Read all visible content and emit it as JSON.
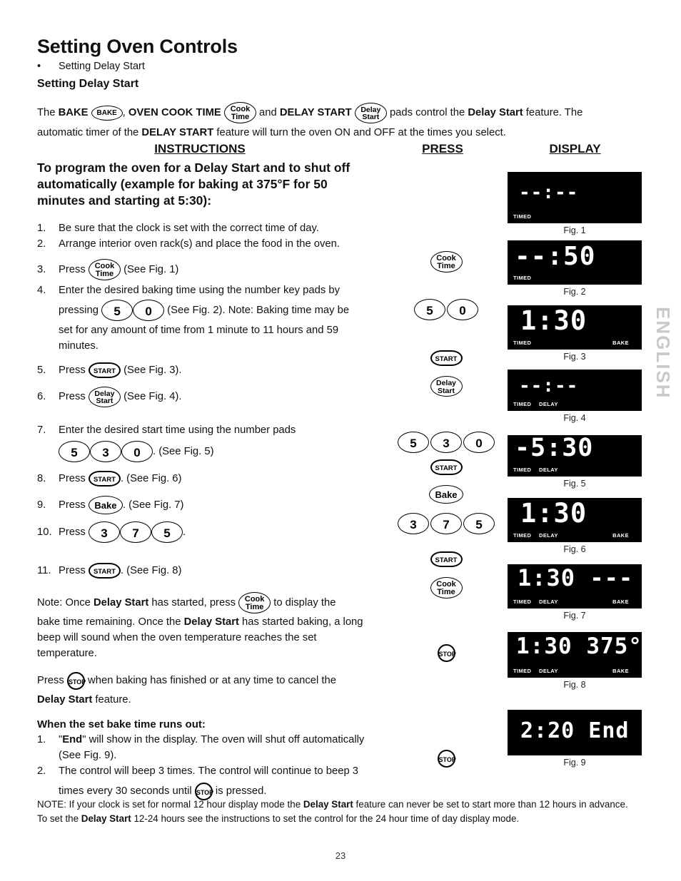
{
  "header": {
    "title": "Setting Oven Controls",
    "bullet": "Setting Delay Start",
    "subtitle": "Setting Delay Start"
  },
  "intro": {
    "p1_a": "The ",
    "p1_bake_label": "BAKE",
    "p1_b": ", ",
    "p1_cook_label": "OVEN COOK TIME",
    "p1_c": " and ",
    "p1_delay_label": "DELAY START",
    "p1_d": " pads control the ",
    "p1_e": "Delay Start",
    "p1_f": " feature. The",
    "p2_a": "automatic timer of the ",
    "p2_b": "DELAY START",
    "p2_c": " feature will turn the oven ON and OFF at the times you select."
  },
  "columns": {
    "instructions": "INSTRUCTIONS",
    "press": "PRESS",
    "display": "DISPLAY"
  },
  "lead": "To program the oven for a Delay Start and to shut off automatically (example for baking at 375°F for 50 minutes and starting at 5:30):",
  "steps": {
    "s1_num": "1.",
    "s1_text": "Be sure that the clock is set with the correct time of day.",
    "s2_num": "2.",
    "s2_text": "Arrange interior oven rack(s) and place the food in the oven.",
    "s3_num": "3.",
    "s3_a": "Press ",
    "s3_b": "(See Fig. 1)",
    "s4_num": "4.",
    "s4_a": "Enter the desired baking time using the number key pads by",
    "s4_b": "pressing ",
    "s4_c": "(See Fig. 2). Note: Baking time may be",
    "s4_d": "set for any amount of time from 1 minute to 11 hours and 59 minutes.",
    "s5_num": "5.",
    "s5_a": "Press ",
    "s5_b": "(See Fig. 3).",
    "s6_num": "6.",
    "s6_a": "Press ",
    "s6_b": "(See Fig. 4).",
    "s7_num": "7.",
    "s7_a": "Enter the desired start time using the number pads",
    "s7_b": ". (See Fig. 5)",
    "s8_num": "8.",
    "s8_a": "Press ",
    "s8_b": ". (See Fig. 6)",
    "s9_num": "9.",
    "s9_a": "Press ",
    "s9_b": ". (See Fig. 7)",
    "s10_num": "10.",
    "s10_a": "Press ",
    "s10_b": ".",
    "s11_num": "11.",
    "s11_a": "Press ",
    "s11_b": ". (See Fig. 8)"
  },
  "notes": {
    "note_a": "Note: Once ",
    "note_b": "Delay Start",
    "note_c": " has started, press ",
    "note_d": " to display the",
    "note_e": "bake time remaining. Once the ",
    "note_f": "Delay Start",
    "note_g": " has started baking, a long beep will sound when the oven temperature reaches the set temperature.",
    "press_a": "Press ",
    "press_b": " when baking has finished or at any time to cancel the",
    "press_c": "Delay Start",
    "press_d": " feature."
  },
  "runout": {
    "heading": "When the set bake time runs out:",
    "r1_num": "1.",
    "r1_a": "\"",
    "r1_b": "End",
    "r1_c": "\" will show in the display. The oven will shut off automatically (See Fig. 9).",
    "r2_num": "2.",
    "r2_a": "The control will beep 3 times. The control will continue to beep 3",
    "r2_b": "times every 30 seconds until ",
    "r2_c": " is pressed."
  },
  "press_column": [
    {
      "row": "r3",
      "pads": "Cook Time"
    },
    {
      "row": "r4",
      "pads": "5 0"
    },
    {
      "row": "r5",
      "pads": "START"
    },
    {
      "row": "r6",
      "pads": "Delay Start"
    },
    {
      "row": "r7",
      "pads": "5 3 0"
    },
    {
      "row": "r8",
      "pads": "START"
    },
    {
      "row": "r9",
      "pads": "Bake"
    },
    {
      "row": "r10",
      "pads": "3 7 5"
    },
    {
      "row": "r11",
      "pads": "START"
    },
    {
      "row": "r12",
      "pads": "Cook Time"
    },
    {
      "row": "r13",
      "pads": "STOP"
    },
    {
      "row": "r14",
      "pads": "STOP"
    }
  ],
  "pad_labels": {
    "cook": "Cook",
    "time": "Time",
    "delay": "Delay",
    "start_word": "Start",
    "start": "START",
    "stop": "STOP",
    "bake": "Bake",
    "bake_caps": "BAKE",
    "n0": "0",
    "n3": "3",
    "n5": "5",
    "n7": "7"
  },
  "figures": [
    {
      "id": "fig1",
      "main": "--:--",
      "timed": "TIMED",
      "delay": "",
      "bake": "",
      "caption": "Fig. 1"
    },
    {
      "id": "fig2",
      "main": "--:50",
      "timed": "TIMED",
      "delay": "",
      "bake": "",
      "caption": "Fig. 2"
    },
    {
      "id": "fig3",
      "main": "1:30",
      "timed": "TIMED",
      "delay": "",
      "bake": "BAKE",
      "caption": "Fig. 3"
    },
    {
      "id": "fig4",
      "main": "--:--",
      "timed": "TIMED",
      "delay": "DELAY",
      "bake": "",
      "caption": "Fig. 4"
    },
    {
      "id": "fig5",
      "main": "-5:30",
      "timed": "TIMED",
      "delay": "DELAY",
      "bake": "",
      "caption": "Fig. 5"
    },
    {
      "id": "fig6",
      "main": "1:30",
      "timed": "TIMED",
      "delay": "DELAY",
      "bake": "BAKE",
      "caption": "Fig. 6"
    },
    {
      "id": "fig7",
      "main": "1:30 ---",
      "timed": "TIMED",
      "delay": "DELAY",
      "bake": "BAKE",
      "caption": "Fig. 7"
    },
    {
      "id": "fig8",
      "main": "1:30 375°",
      "timed": "TIMED",
      "delay": "DELAY",
      "bake": "BAKE",
      "caption": "Fig. 8"
    },
    {
      "id": "fig9",
      "main": "2:20 End",
      "timed": "",
      "delay": "",
      "bake": "",
      "caption": "Fig. 9"
    }
  ],
  "footer": {
    "note_a": "NOTE: If your clock is set for normal 12 hour display mode the ",
    "note_b": "Delay Start",
    "note_c": " feature can never be set to start more than 12 hours in advance. To set the ",
    "note_d": "Delay Start",
    "note_e": " 12-24 hours see the instructions to set the control for the 24 hour time of day display mode.",
    "page_number": "23",
    "side_tab": "ENGLISH"
  },
  "colors": {
    "lcd_background": "#000000",
    "lcd_text": "#ffffff",
    "page_background": "#ffffff",
    "ink": "#111111",
    "side_tab": "#c9c9c9"
  }
}
